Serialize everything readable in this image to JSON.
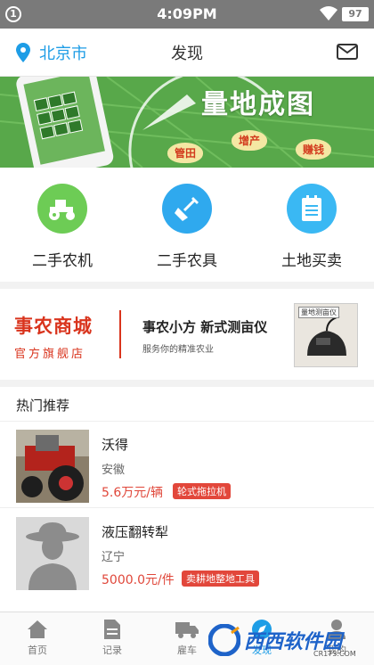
{
  "status_bar": {
    "notification_count": "1",
    "time": "4:09PM",
    "battery": "97"
  },
  "nav": {
    "city": "北京市",
    "title": "发现"
  },
  "banner": {
    "brand": "量地成图",
    "tags": [
      "管田",
      "增产",
      "赚钱"
    ]
  },
  "categories": [
    {
      "label": "二手农机",
      "icon": "tractor-icon",
      "color": "#6dcc55"
    },
    {
      "label": "二手农具",
      "icon": "shovel-icon",
      "color": "#2fa9ee"
    },
    {
      "label": "土地买卖",
      "icon": "document-icon",
      "color": "#3ab8f3"
    }
  ],
  "promo": {
    "shop_name": "事农商城",
    "shop_sub": "官方旗舰店",
    "headline": "事农小方  新式测亩仪",
    "desc": "服务你的精准农业",
    "product_tag": "量地测亩仪"
  },
  "recommend": {
    "title": "热门推荐",
    "items": [
      {
        "name": "沃得",
        "location": "安徽",
        "price": "5.6万元/辆",
        "badge": "轮式拖拉机"
      },
      {
        "name": "液压翻转犁",
        "location": "辽宁",
        "price": "5000.0元/件",
        "badge": "卖耕地整地工具"
      }
    ]
  },
  "tabs": [
    {
      "label": "首页",
      "icon": "home-icon"
    },
    {
      "label": "记录",
      "icon": "record-icon"
    },
    {
      "label": "雇车",
      "icon": "truck-icon"
    },
    {
      "label": "发现",
      "icon": "discover-icon",
      "active": true
    },
    {
      "label": "我的",
      "icon": "profile-icon"
    }
  ],
  "watermark": {
    "text": "西西软件园",
    "url": "CR173.COM"
  },
  "colors": {
    "accent": "#1e9de6",
    "price": "#e0473a",
    "brand_red": "#d9341d"
  }
}
